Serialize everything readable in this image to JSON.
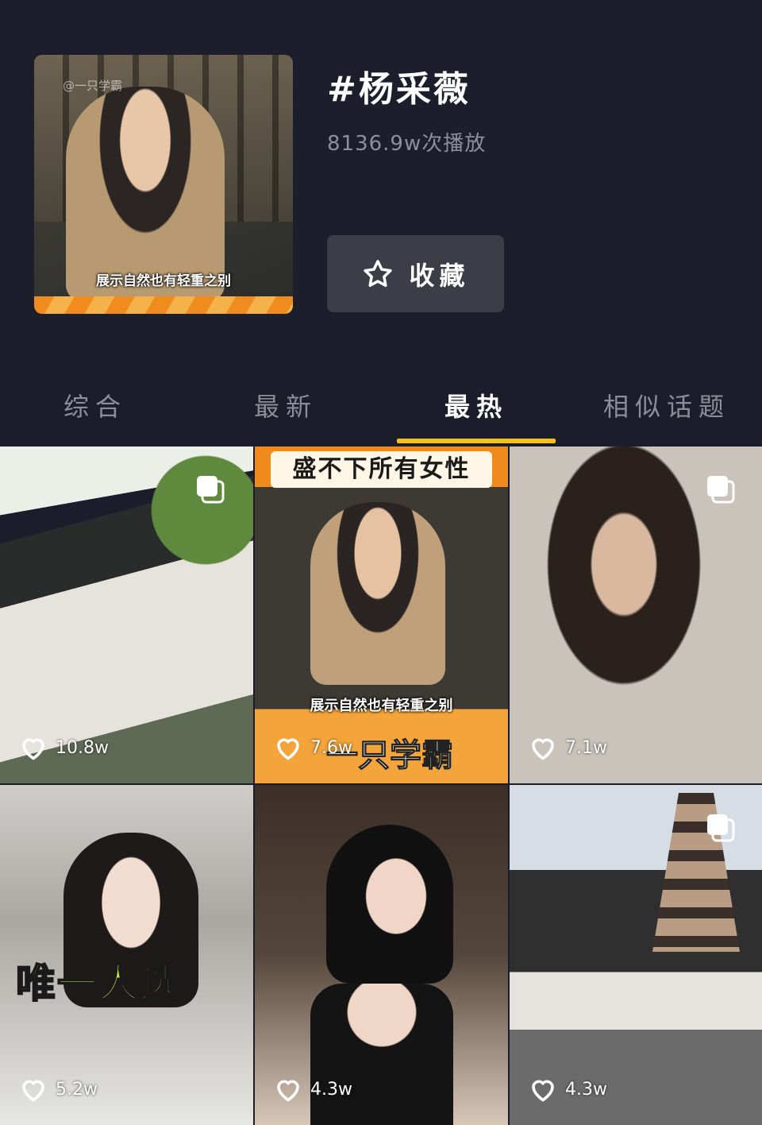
{
  "topic": {
    "cover_watermark": "@一只学霸",
    "cover_caption": "展示自然也有轻重之别",
    "title": "#杨采薇",
    "plays": "8136.9w次播放",
    "favorite_label": "收藏"
  },
  "tabs": [
    {
      "label": "综合",
      "active": false
    },
    {
      "label": "最新",
      "active": false
    },
    {
      "label": "最热",
      "active": true
    },
    {
      "label": "相似话题",
      "active": false
    }
  ],
  "posts": [
    {
      "likes": "10.8w",
      "multi_image": true
    },
    {
      "likes": "7.6w",
      "multi_image": false,
      "banner": "盛不下所有女性",
      "watermark": "@一只学霸",
      "caption": "展示自然也有轻重之别",
      "brand": "一只学霸"
    },
    {
      "likes": "7.1w",
      "multi_image": true
    },
    {
      "likes": "5.2w",
      "multi_image": false,
      "sticker": "唯一人选"
    },
    {
      "likes": "4.3w",
      "multi_image": false
    },
    {
      "likes": "4.3w",
      "multi_image": true
    }
  ],
  "colors": {
    "background": "#1c1e2b",
    "tab_active_underline": "#f5c21b",
    "button_bg": "#3b3d47"
  }
}
